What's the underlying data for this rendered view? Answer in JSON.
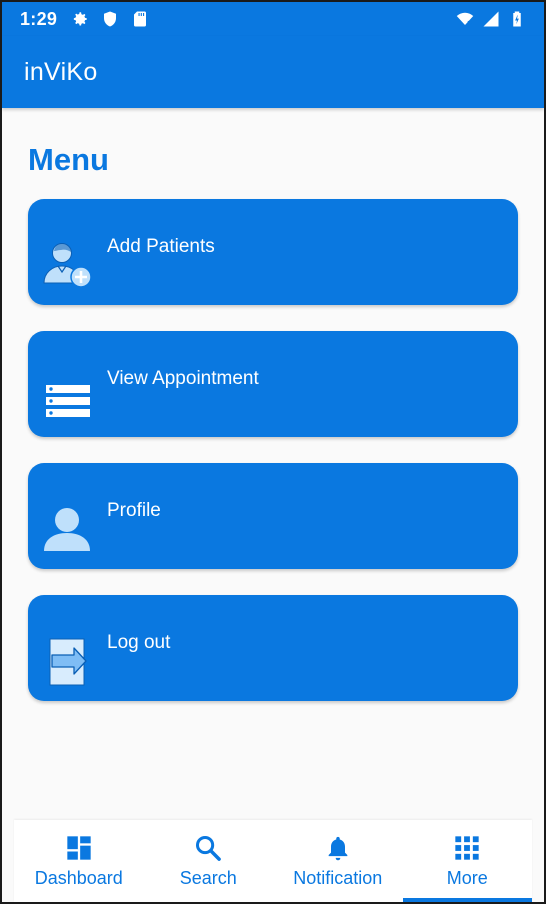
{
  "status_bar": {
    "time": "1:29",
    "left_icons": [
      "gear-icon",
      "shield-icon",
      "sd-card-icon"
    ],
    "right_icons": [
      "wifi-icon",
      "signal-icon",
      "battery-icon"
    ]
  },
  "app_bar": {
    "title": "inViKo"
  },
  "page": {
    "title": "Menu"
  },
  "menu": {
    "items": [
      {
        "label": "Add Patients",
        "icon": "add-patient-icon"
      },
      {
        "label": "View Appointment",
        "icon": "list-icon"
      },
      {
        "label": "Profile",
        "icon": "person-icon"
      },
      {
        "label": "Log out",
        "icon": "logout-icon"
      }
    ]
  },
  "bottom_nav": {
    "items": [
      {
        "label": "Dashboard",
        "icon": "dashboard-icon"
      },
      {
        "label": "Search",
        "icon": "search-icon"
      },
      {
        "label": "Notification",
        "icon": "bell-icon"
      },
      {
        "label": "More",
        "icon": "grid-icon"
      }
    ],
    "active": "More"
  },
  "colors": {
    "primary": "#0a78e0",
    "background": "#fafafa",
    "icon_light": "#bfe0fb"
  }
}
